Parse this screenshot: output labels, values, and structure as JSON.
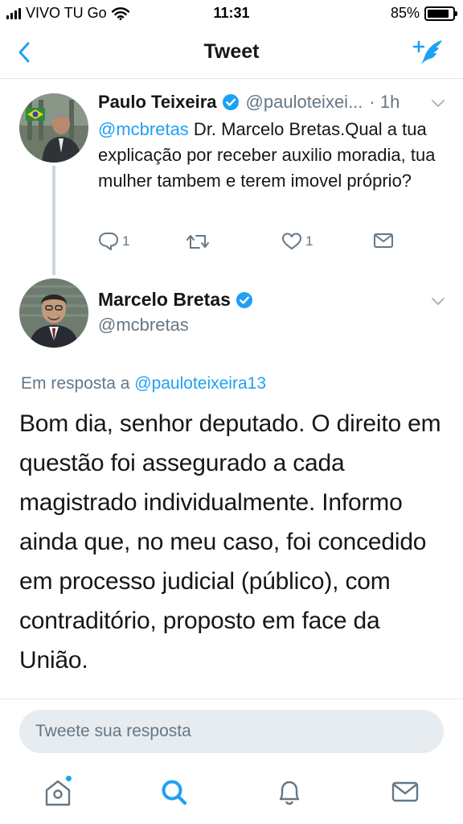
{
  "status_bar": {
    "carrier": "VIVO TU Go",
    "time": "11:31",
    "battery": "85%",
    "battery_level": 0.85
  },
  "nav": {
    "title": "Tweet",
    "back_icon": "chevron-left-icon",
    "compose_icon": "compose-tweet-icon"
  },
  "tweet_parent": {
    "name": "Paulo Teixeira",
    "handle": "@pauloteixei...",
    "time": "· 1h",
    "mention": "@mcbretas",
    "text": " Dr. Marcelo Bretas.Qual a tua explicação por receber auxilio moradia, tua mulher tambem e terem imovel próprio?",
    "actions": {
      "reply_count": "1",
      "retweet_count": "",
      "like_count": "1"
    }
  },
  "tweet_main": {
    "name": "Marcelo Bretas",
    "handle": "@mcbretas",
    "reply_prefix": "Em resposta a",
    "reply_handle": "@pauloteixeira13",
    "text": "Bom dia, senhor deputado. O direito em questão foi assegurado a cada magistrado individualmente. Informo ainda que, no meu caso, foi concedido em processo judicial (público), com contraditório, proposto em face da União."
  },
  "reply_box": {
    "placeholder": "Tweete sua resposta"
  },
  "tab_bar": {
    "tabs": [
      "home-icon",
      "search-icon",
      "notifications-icon",
      "messages-icon"
    ]
  },
  "colors": {
    "accent": "#1da1f2",
    "text": "#14171a",
    "secondary": "#657786",
    "divider": "#e1e8ed"
  }
}
